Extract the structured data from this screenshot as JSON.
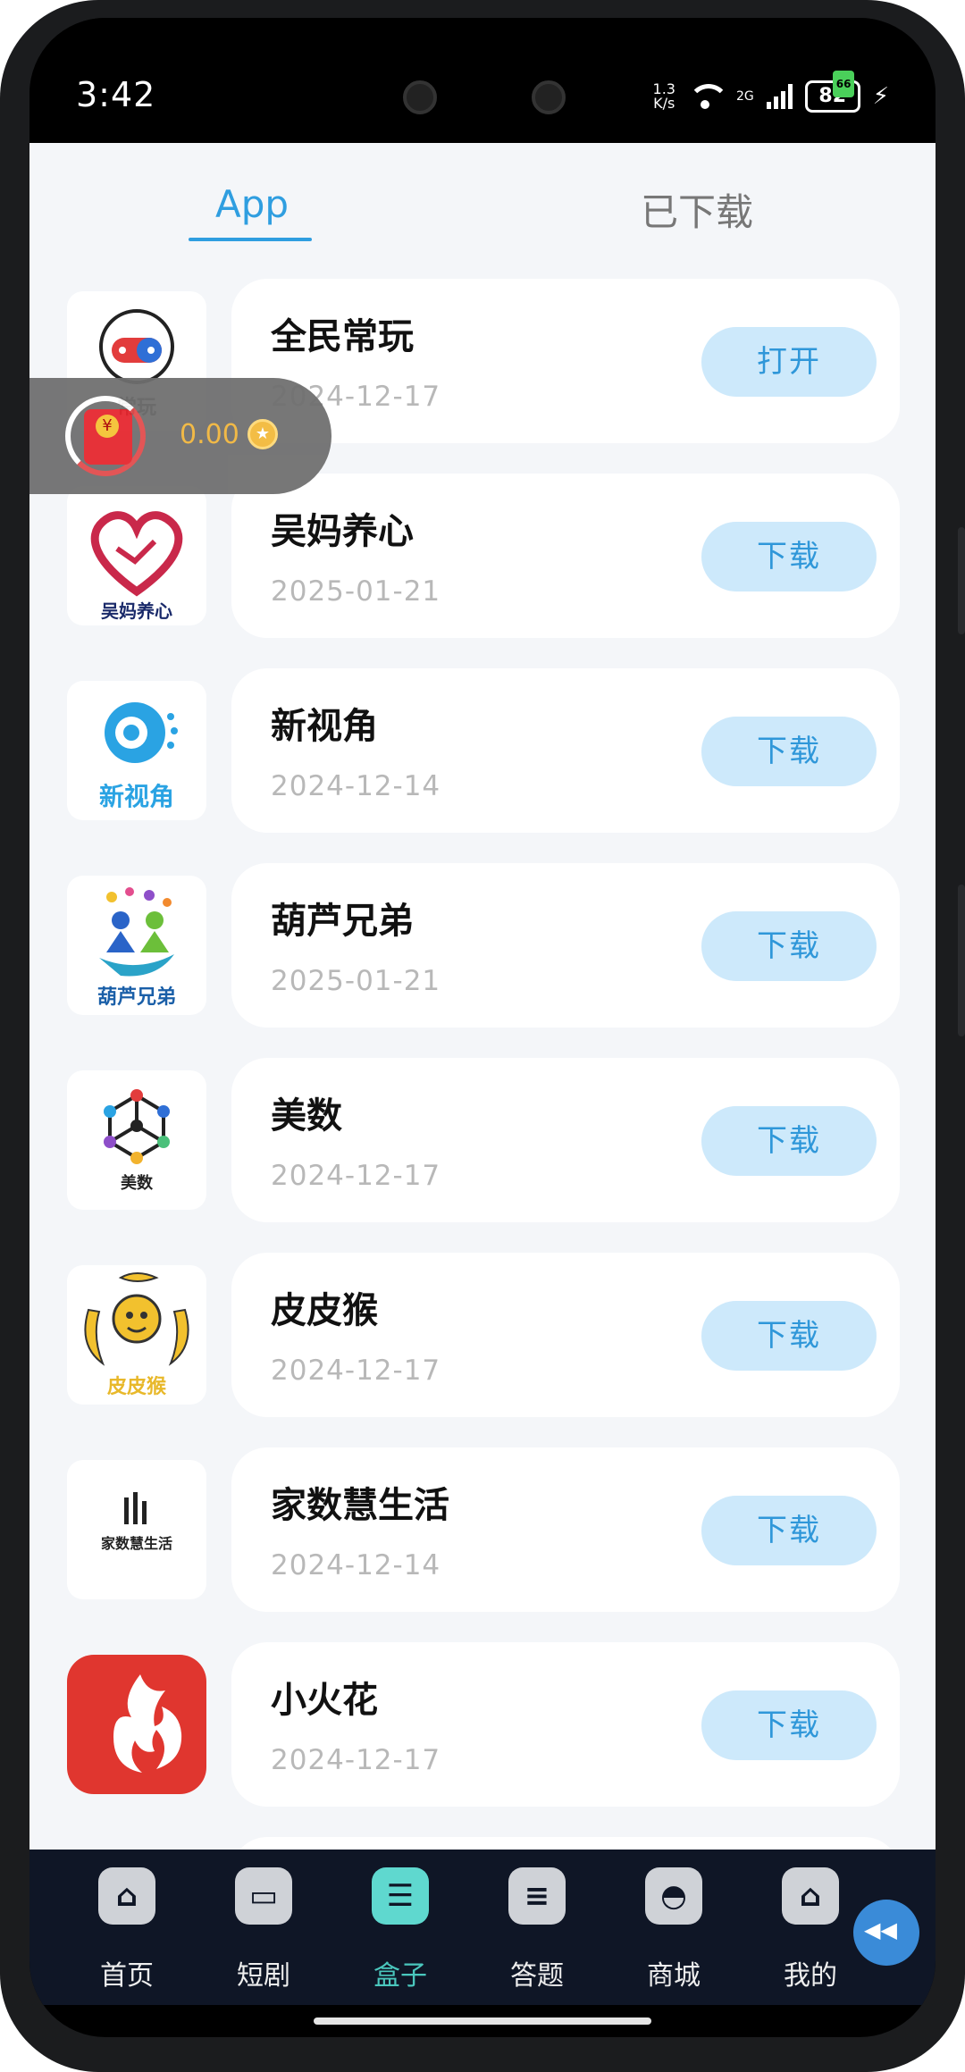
{
  "status_bar": {
    "time": "3:42",
    "speed_top": "1.3",
    "speed_bottom": "K/s",
    "network": "2G",
    "battery": "82",
    "battery_badge": "66"
  },
  "tabs": [
    {
      "label": "App",
      "active": true
    },
    {
      "label": "已下载",
      "active": false
    }
  ],
  "apps": [
    {
      "name": "全民常玩",
      "date": "2024-12-17",
      "action": "打开",
      "icon": "gamepad-icon",
      "caption": "常玩"
    },
    {
      "name": "吴妈养心",
      "date": "2025-01-21",
      "action": "下载",
      "icon": "heart-hands-icon",
      "caption": "吴妈养心"
    },
    {
      "name": "新视角",
      "date": "2024-12-14",
      "action": "下载",
      "icon": "eye-icon",
      "caption": "新视角"
    },
    {
      "name": "葫芦兄弟",
      "date": "2025-01-21",
      "action": "下载",
      "icon": "children-icon",
      "caption": "葫芦兄弟"
    },
    {
      "name": "美数",
      "date": "2024-12-17",
      "action": "下载",
      "icon": "network-cube-icon",
      "caption": "美数"
    },
    {
      "name": "皮皮猴",
      "date": "2024-12-17",
      "action": "下载",
      "icon": "monkey-banana-icon",
      "caption": "皮皮猴"
    },
    {
      "name": "家数慧生活",
      "date": "2024-12-14",
      "action": "下载",
      "icon": "bars-icon",
      "caption": "家数慧生活"
    },
    {
      "name": "小火花",
      "date": "2024-12-17",
      "action": "下载",
      "icon": "flame-icon",
      "caption": ""
    }
  ],
  "float_widget": {
    "amount": "0.00",
    "icon": "red-envelope-icon"
  },
  "bottom_nav": [
    {
      "label": "首页",
      "icon": "home-icon",
      "active": false
    },
    {
      "label": "短剧",
      "icon": "clapperboard-icon",
      "active": false
    },
    {
      "label": "盒子",
      "icon": "box-icon",
      "active": true
    },
    {
      "label": "答题",
      "icon": "quiz-icon",
      "active": false
    },
    {
      "label": "商城",
      "icon": "shopping-bag-icon",
      "active": false
    },
    {
      "label": "我的",
      "icon": "profile-icon",
      "active": false
    }
  ],
  "colors": {
    "accent": "#2f9ee0",
    "button_bg": "#cde9fb",
    "nav_bg": "#0f1626",
    "nav_active": "#4ac7bd"
  }
}
